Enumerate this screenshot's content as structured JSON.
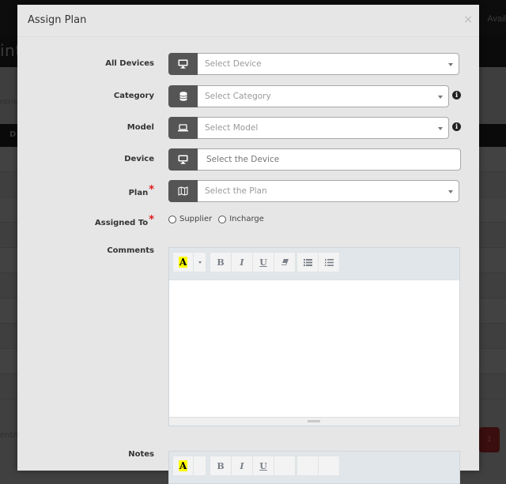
{
  "backdrop": {
    "page_title_fragment": "int",
    "nav_fragment": "Avail",
    "entries_top_fragment": "ntries",
    "table_header_fragment": "D",
    "entries_bottom_fragment": "entri",
    "pagination_current": "1"
  },
  "modal": {
    "title": "Assign Plan",
    "close_label": "×",
    "fields": {
      "all_devices": {
        "label": "All Devices",
        "placeholder": "Select Device",
        "icon": "desktop-icon"
      },
      "category": {
        "label": "Category",
        "placeholder": "Select Category",
        "icon": "database-icon",
        "info": "i"
      },
      "model": {
        "label": "Model",
        "placeholder": "Select Model",
        "icon": "laptop-icon",
        "info": "i"
      },
      "device": {
        "label": "Device",
        "placeholder": "Select the Device",
        "icon": "desktop-icon"
      },
      "plan": {
        "label": "Plan",
        "placeholder": "Select the Plan",
        "icon": "map-icon",
        "required": "*"
      },
      "assigned_to": {
        "label": "Assigned To",
        "required": "*",
        "options": [
          "Supplier",
          "Incharge"
        ]
      },
      "comments": {
        "label": "Comments"
      },
      "notes": {
        "label": "Notes"
      }
    },
    "toolbar": {
      "font_color": "A",
      "bold": "B",
      "italic": "I",
      "underline": "U"
    }
  },
  "colors": {
    "addon": "#555555",
    "required": "#e01919",
    "highlight": "#ffff00",
    "modal_bg": "#e6e6e6"
  }
}
